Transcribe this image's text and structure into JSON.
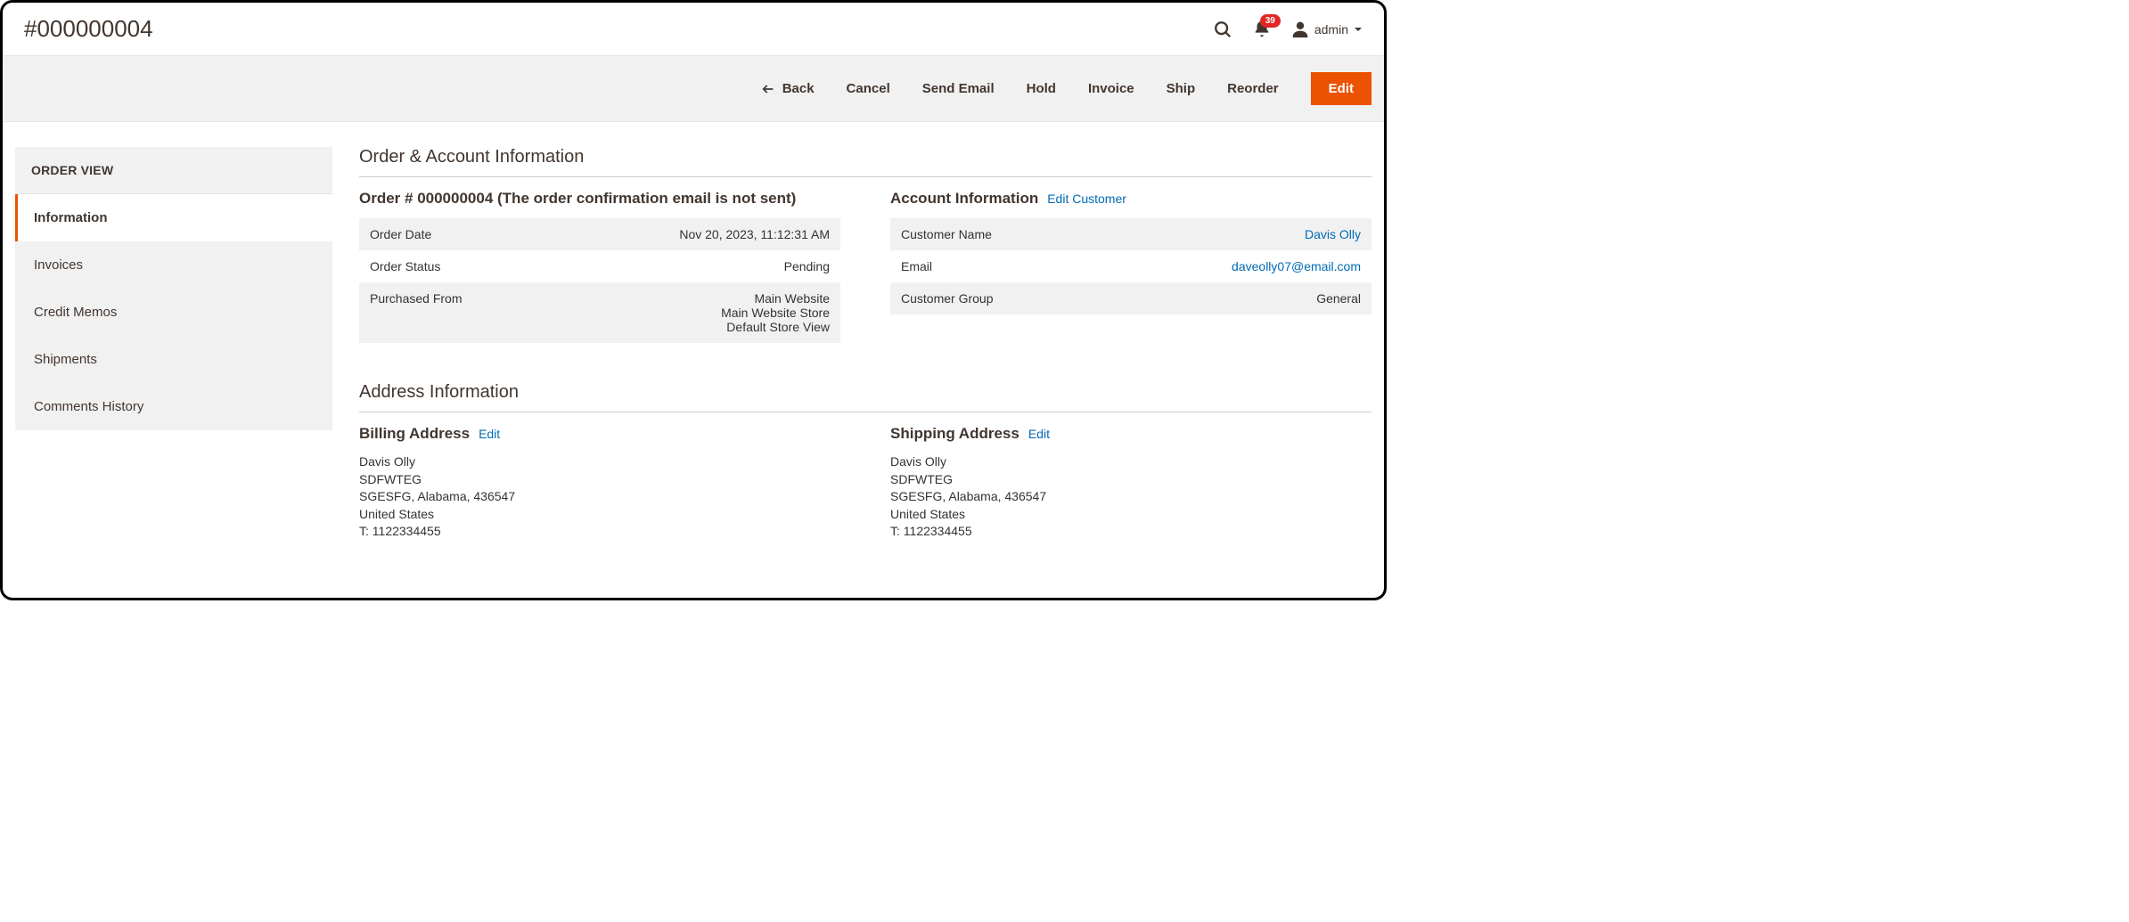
{
  "header": {
    "title": "#000000004",
    "notification_count": "39",
    "user_label": "admin"
  },
  "actions": {
    "back": "Back",
    "cancel": "Cancel",
    "send_email": "Send Email",
    "hold": "Hold",
    "invoice": "Invoice",
    "ship": "Ship",
    "reorder": "Reorder",
    "edit": "Edit"
  },
  "sidebar": {
    "title": "ORDER VIEW",
    "items": [
      {
        "label": "Information",
        "active": true
      },
      {
        "label": "Invoices",
        "active": false
      },
      {
        "label": "Credit Memos",
        "active": false
      },
      {
        "label": "Shipments",
        "active": false
      },
      {
        "label": "Comments History",
        "active": false
      }
    ]
  },
  "sections": {
    "order_account": "Order & Account Information",
    "order_block_title": "Order # 000000004 (The order confirmation email is not sent)",
    "order_rows": {
      "date_label": "Order Date",
      "date_value": "Nov 20, 2023, 11:12:31 AM",
      "status_label": "Order Status",
      "status_value": "Pending",
      "from_label": "Purchased From",
      "from_value": "Main Website\nMain Website Store\nDefault Store View"
    },
    "account_block_title": "Account Information",
    "edit_customer": "Edit Customer",
    "account_rows": {
      "name_label": "Customer Name",
      "name_value": "Davis Olly",
      "email_label": "Email",
      "email_value": "daveolly07@email.com",
      "group_label": "Customer Group",
      "group_value": "General"
    },
    "address_info": "Address Information",
    "billing_title": "Billing Address",
    "shipping_title": "Shipping Address",
    "edit": "Edit",
    "billing_address": "Davis Olly\nSDFWTEG\nSGESFG, Alabama, 436547\nUnited States\nT: 1122334455",
    "shipping_address": "Davis Olly\nSDFWTEG\nSGESFG, Alabama, 436547\nUnited States\nT: 1122334455"
  }
}
